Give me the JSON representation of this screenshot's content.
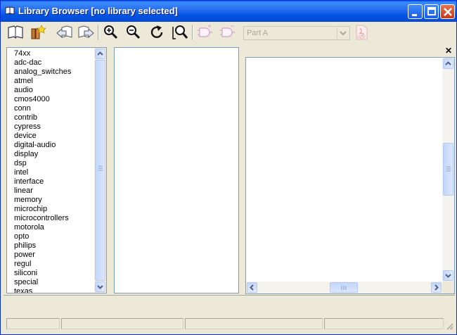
{
  "window": {
    "title": "Library Browser [no library selected]"
  },
  "toolbar": {
    "part_select": {
      "value": "Part A"
    },
    "tools": [
      {
        "name": "open-library-icon"
      },
      {
        "name": "library-settings-icon"
      },
      {
        "name": "previous-icon"
      },
      {
        "name": "next-icon"
      },
      {
        "name": "zoom-in-icon"
      },
      {
        "name": "zoom-out-icon"
      },
      {
        "name": "refresh-icon"
      },
      {
        "name": "zoom-fit-icon"
      },
      {
        "name": "add-part-icon"
      },
      {
        "name": "remove-part-icon"
      },
      {
        "name": "pdf-icon"
      }
    ]
  },
  "libraries": [
    "74xx",
    "adc-dac",
    "analog_switches",
    "atmel",
    "audio",
    "cmos4000",
    "conn",
    "contrib",
    "cypress",
    "device",
    "digital-audio",
    "display",
    "dsp",
    "intel",
    "interface",
    "linear",
    "memory",
    "microchip",
    "microcontrollers",
    "motorola",
    "opto",
    "philips",
    "power",
    "regul",
    "siliconi",
    "special",
    "texas"
  ],
  "preview": {
    "close_label": "✕"
  }
}
